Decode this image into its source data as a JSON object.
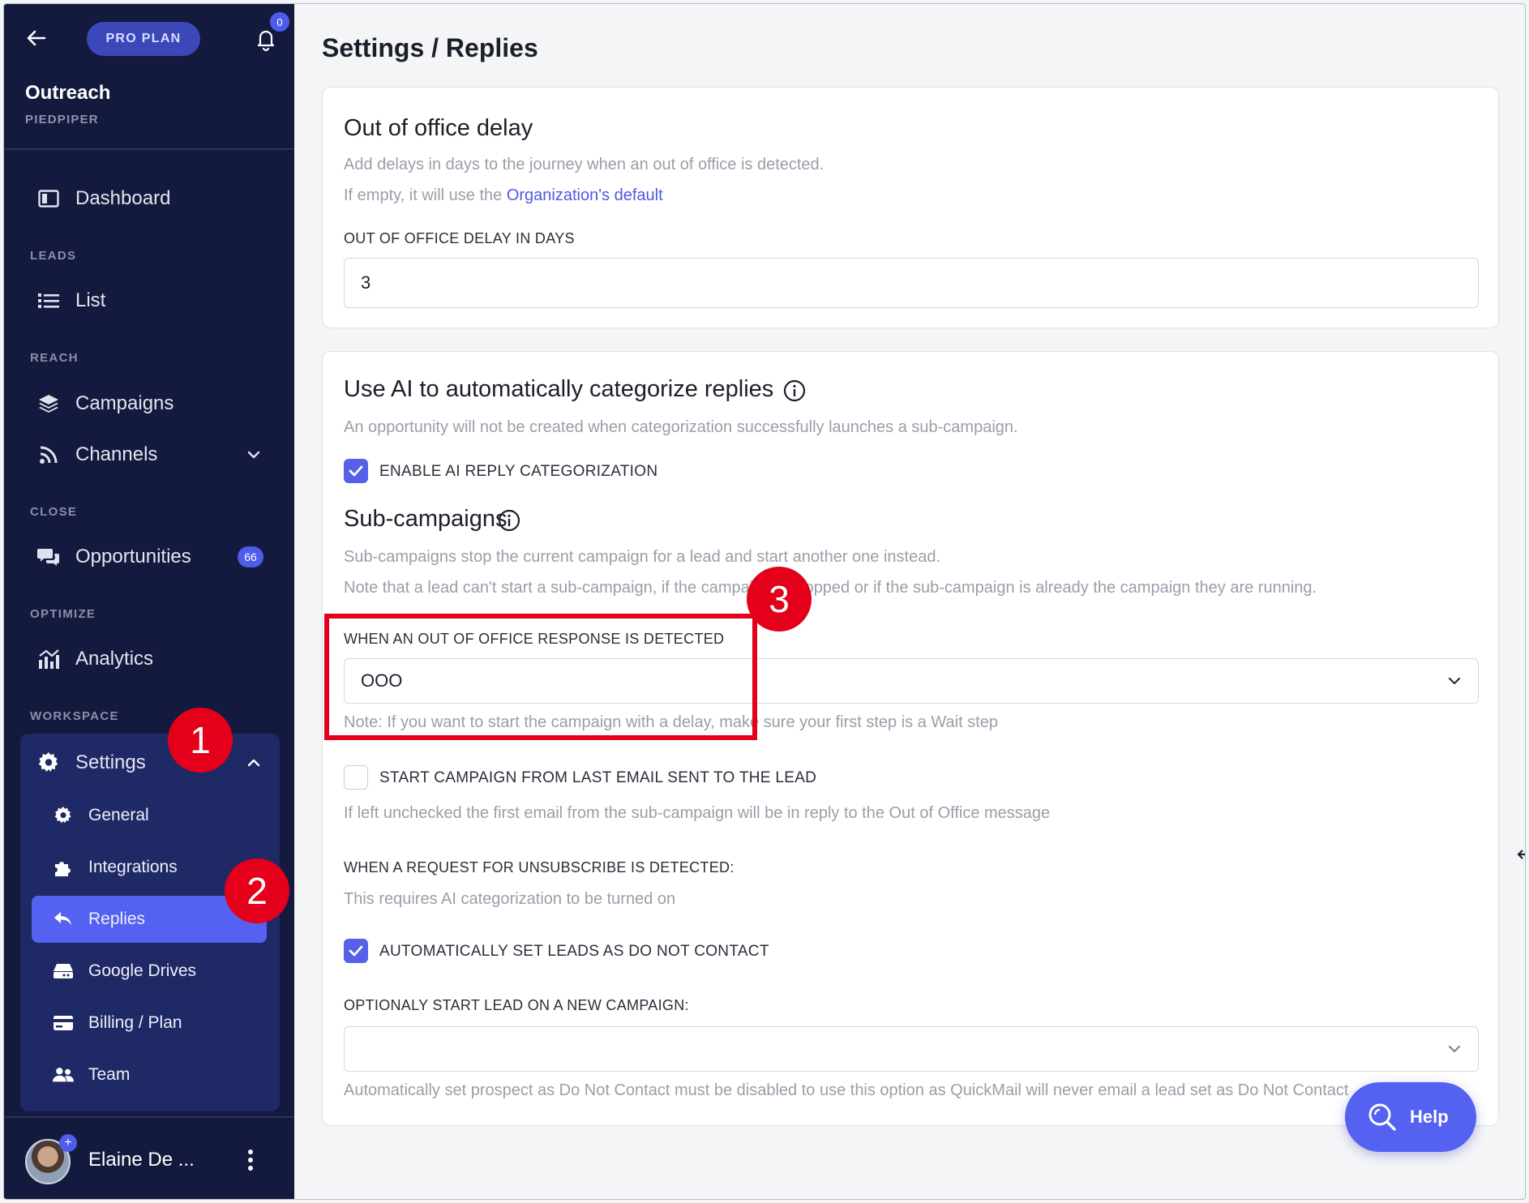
{
  "sidebar": {
    "plan_label": "PRO PLAN",
    "notification_count": "0",
    "org_name": "Outreach",
    "org_subtitle": "PIEDPIPER",
    "dashboard": "Dashboard",
    "section_leads": "LEADS",
    "list": "List",
    "section_reach": "REACH",
    "campaigns": "Campaigns",
    "channels": "Channels",
    "section_close": "CLOSE",
    "opportunities": "Opportunities",
    "opportunities_count": "66",
    "section_optimize": "OPTIMIZE",
    "analytics": "Analytics",
    "section_workspace": "WORKSPACE",
    "settings": "Settings",
    "settings_items": [
      "General",
      "Integrations",
      "Replies",
      "Google Drives",
      "Billing / Plan",
      "Team"
    ],
    "active_item": "Replies",
    "user_name": "Elaine De ..."
  },
  "page": {
    "title": "Settings / Replies"
  },
  "ooo_card": {
    "heading": "Out of office delay",
    "desc": "Add delays in days to the journey when an out of office is detected.",
    "default_prefix": "If empty, it will use the",
    "default_link": "Organization's default",
    "field_label": "OUT OF OFFICE DELAY IN DAYS",
    "field_value": "3"
  },
  "ai_card": {
    "heading": "Use AI to automatically categorize replies",
    "desc": "An opportunity will not be created when categorization successfully launches a sub-campaign.",
    "enable_label": "ENABLE AI REPLY CATEGORIZATION",
    "enable_checked": true,
    "sub_heading": "Sub-campaigns",
    "sub_desc1": "Sub-campaigns stop the current campaign for a lead and start another one instead.",
    "sub_desc2": "Note that a lead can't start a sub-campaign, if the campaign is stopped or if the sub-campaign is already the campaign they are running.",
    "ooo_label": "WHEN AN OUT OF OFFICE RESPONSE IS DETECTED",
    "ooo_value": "OOO",
    "ooo_note": "Note: If you want to start the campaign with a delay, make sure your first step is a Wait step",
    "last_email_label": "START CAMPAIGN FROM LAST EMAIL SENT TO THE LEAD",
    "last_email_checked": false,
    "last_email_note": "If left unchecked the first email from the sub-campaign will be in reply to the Out of Office message",
    "unsub_label": "WHEN A REQUEST FOR UNSUBSCRIBE IS DETECTED:",
    "unsub_note": "This requires AI categorization to be turned on",
    "dnc_label": "AUTOMATICALLY SET LEADS AS DO NOT CONTACT",
    "dnc_checked": true,
    "new_campaign_label": "OPTIONALY START LEAD ON A NEW CAMPAIGN:",
    "new_campaign_value": "",
    "new_campaign_note": "Automatically set prospect as Do Not Contact must be disabled to use this option as QuickMail will never email a lead set as Do Not Contact"
  },
  "help": {
    "label": "Help"
  },
  "annotations": {
    "step1": "1",
    "step2": "2",
    "step3": "3"
  },
  "colors": {
    "sidebar_bg": "#131a3d",
    "accent": "#5561f0",
    "callout_red": "#e4001a"
  }
}
